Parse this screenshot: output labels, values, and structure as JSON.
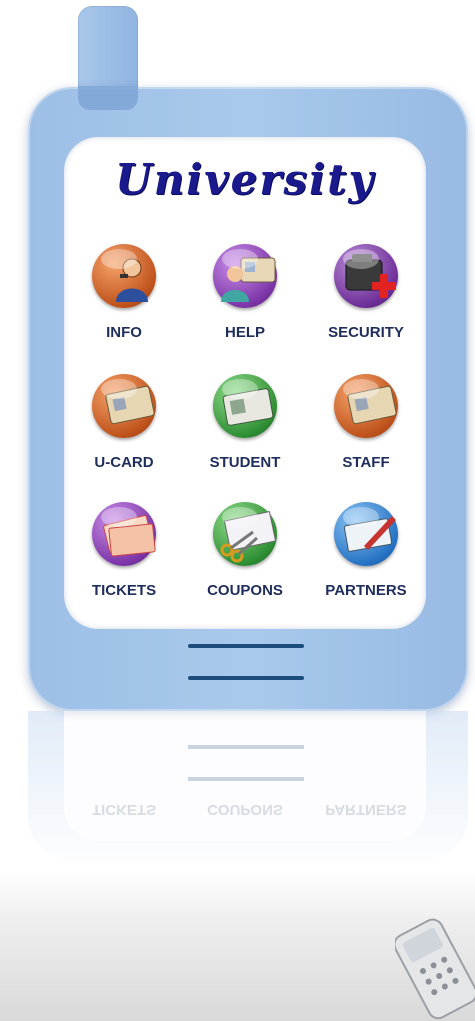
{
  "app": {
    "title": "University"
  },
  "colors": {
    "phone_body": "#a9c9ec",
    "title": "#1a1a8c",
    "label": "#1f2d5c",
    "bars": "#1d4d7d"
  },
  "menu": {
    "items": [
      {
        "label": "INFO",
        "icon": "person-info-icon",
        "color": "#d2692e"
      },
      {
        "label": "HELP",
        "icon": "person-card-icon",
        "color": "#8a3fb6"
      },
      {
        "label": "SECURITY",
        "icon": "security-cross-icon",
        "color": "#7a3aa8"
      },
      {
        "label": "U-CARD",
        "icon": "id-card-icon",
        "color": "#d2692e"
      },
      {
        "label": "STUDENT",
        "icon": "student-card-icon",
        "color": "#2f9a3a"
      },
      {
        "label": "STAFF",
        "icon": "staff-card-icon",
        "color": "#d2692e"
      },
      {
        "label": "TICKETS",
        "icon": "tickets-icon",
        "color": "#8a3fb6"
      },
      {
        "label": "COUPONS",
        "icon": "coupons-scissors-icon",
        "color": "#2f9a3a"
      },
      {
        "label": "PARTNERS",
        "icon": "partners-pen-icon",
        "color": "#2b7fd0"
      }
    ]
  }
}
